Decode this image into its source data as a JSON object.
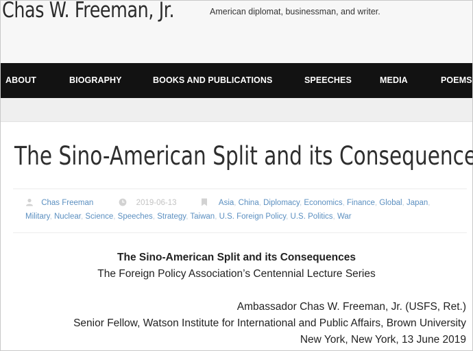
{
  "site": {
    "title": "Chas W. Freeman, Jr.",
    "tagline": "American diplomat, businessman, and writer."
  },
  "nav": {
    "items": [
      "ABOUT",
      "BIOGRAPHY",
      "BOOKS AND PUBLICATIONS",
      "SPEECHES",
      "MEDIA",
      "POEMS"
    ]
  },
  "post": {
    "title": "The Sino-American Split and its Consequences",
    "meta": {
      "author": "Chas Freeman",
      "date": "2019-06-13",
      "categories": [
        "Asia",
        "China",
        "Diplomacy",
        "Economics",
        "Finance",
        "Global",
        "Japan",
        "Military",
        "Nuclear",
        "Science",
        "Speeches",
        "Strategy",
        "Taiwan",
        "U.S. Foreign Policy",
        "U.S. Politics",
        "War"
      ]
    },
    "body": {
      "heading": "The Sino-American Split and its Consequences",
      "subheading": "The Foreign Policy Association’s Centennial Lecture Series",
      "byline": "Ambassador Chas W. Freeman, Jr. (USFS, Ret.)",
      "affiliation": "Senior Fellow, Watson Institute for International and Public Affairs, Brown University",
      "location_date": "New York, New York, 13 June 2019"
    }
  },
  "icons": {
    "author": "user-icon",
    "date": "clock-icon",
    "categories": "bookmark-icon"
  },
  "colors": {
    "nav_bg": "#121212",
    "link": "#5b8fc0",
    "meta_muted": "#c5c5c5"
  }
}
